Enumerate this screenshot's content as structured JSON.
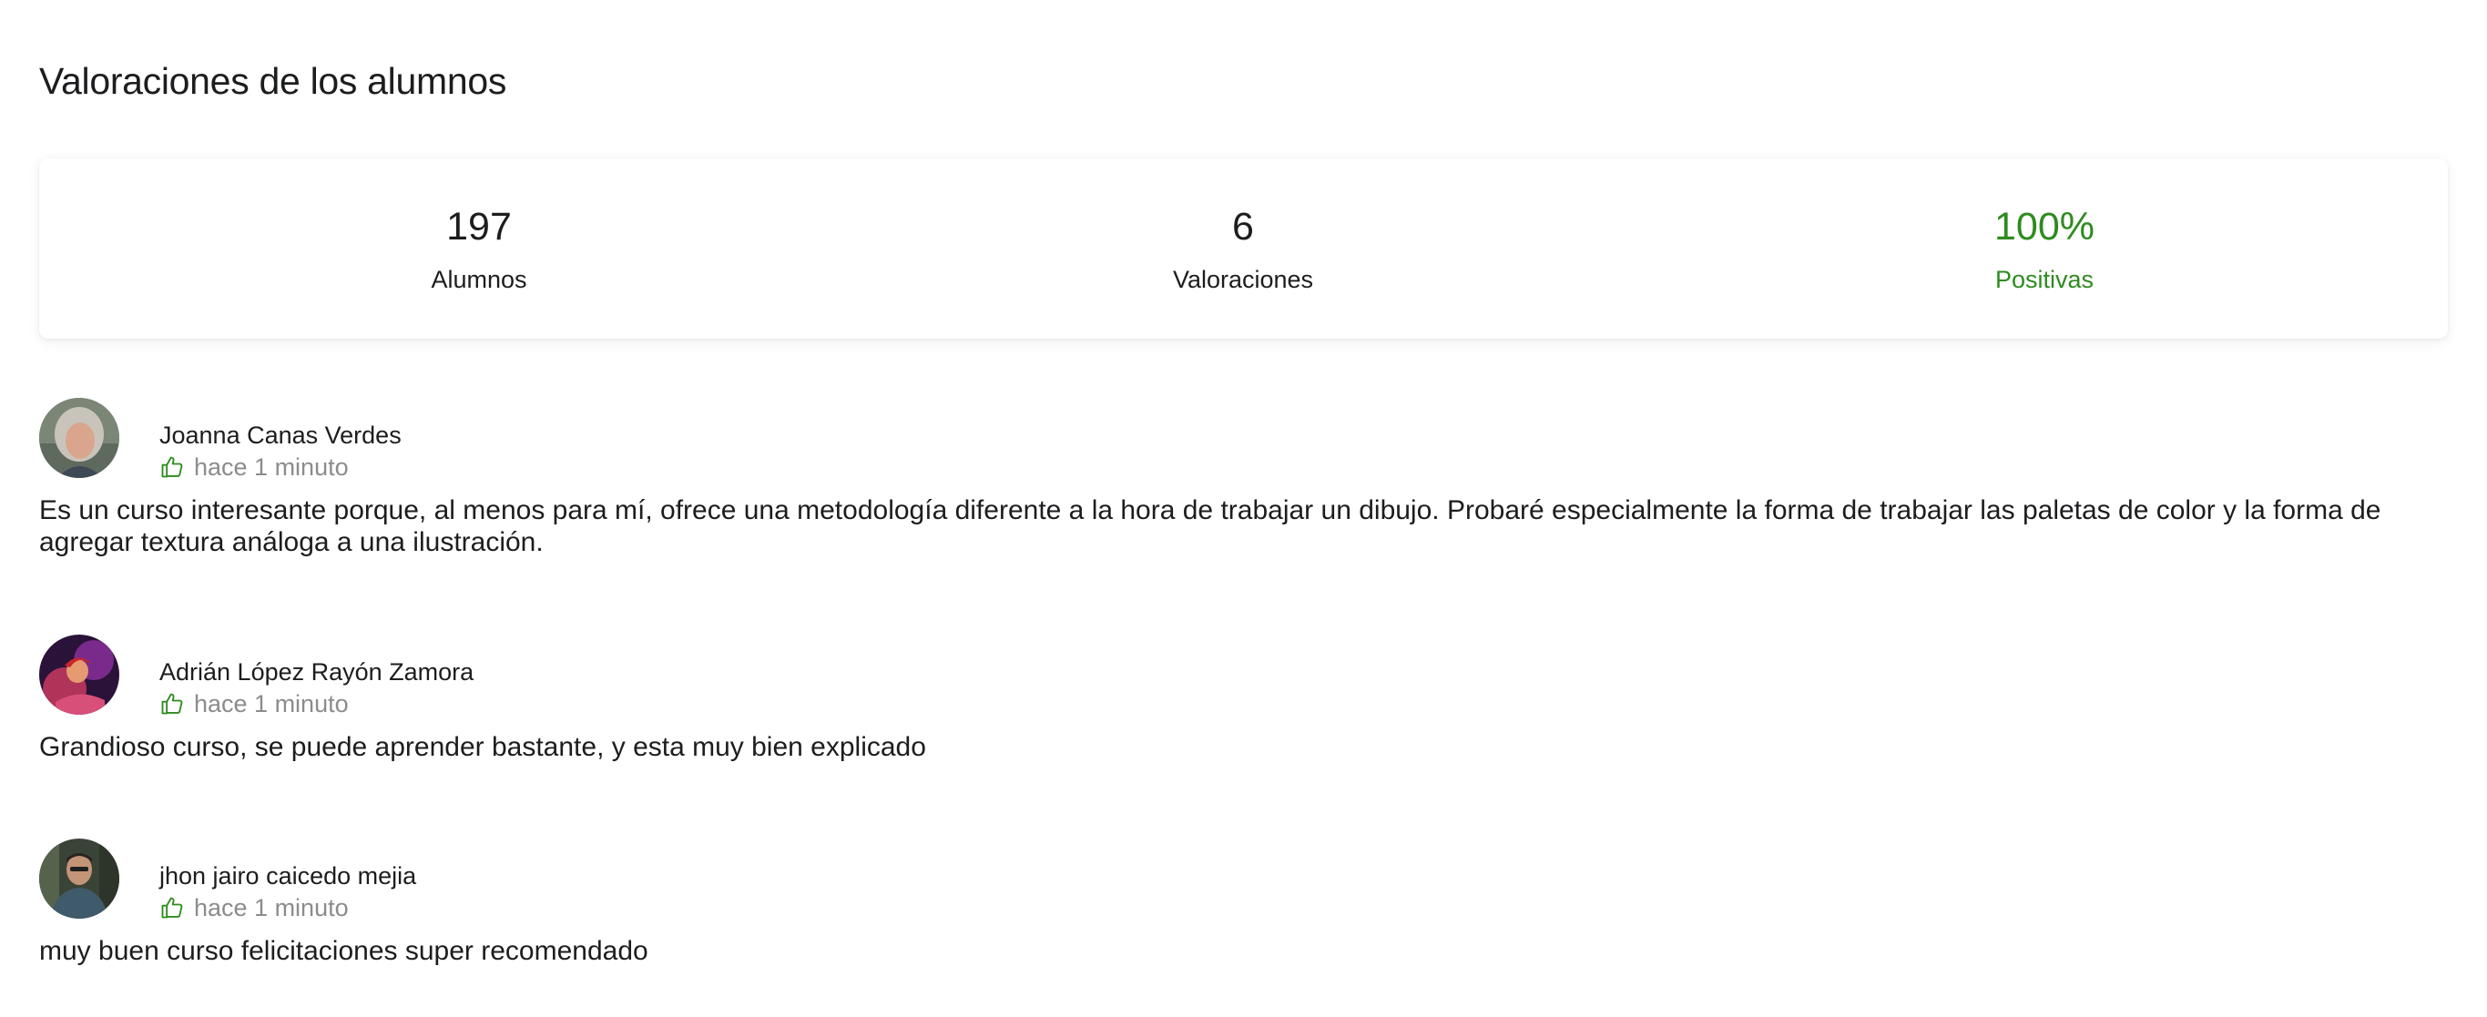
{
  "section": {
    "title": "Valoraciones de los alumnos"
  },
  "stats": {
    "students": {
      "value": "197",
      "label": "Alumnos"
    },
    "ratings": {
      "value": "6",
      "label": "Valoraciones"
    },
    "positive": {
      "value": "100%",
      "label": "Positivas"
    }
  },
  "colors": {
    "accent_green": "#2e8b1f",
    "text": "#1c1d1f",
    "muted": "#8c8c8c"
  },
  "reviews": [
    {
      "name": "Joanna Canas Verdes",
      "icon": "thumbs-up-icon",
      "time": "hace 1 minuto",
      "text": "Es un curso interesante porque, al menos para mí, ofrece una metodología diferente a la hora de trabajar un dibujo. Probaré especialmente la forma de trabajar las paletas de color y la forma de agregar textura análoga a una ilustración."
    },
    {
      "name": "Adrián López Rayón Zamora",
      "icon": "thumbs-up-icon",
      "time": "hace 1 minuto",
      "text": "Grandioso curso, se puede aprender bastante, y esta muy bien explicado"
    },
    {
      "name": "jhon jairo caicedo mejia",
      "icon": "thumbs-up-icon",
      "time": "hace 1 minuto",
      "text": "muy buen curso felicitaciones super recomendado"
    }
  ]
}
